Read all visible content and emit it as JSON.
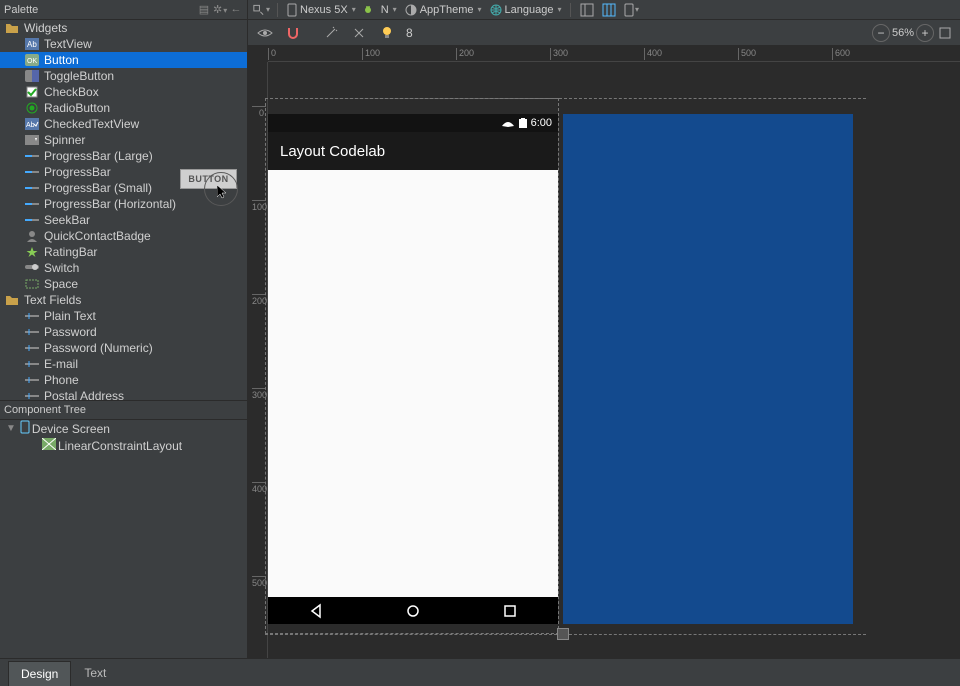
{
  "palette": {
    "title": "Palette",
    "groups": {
      "widgets_label": "Widgets",
      "text_fields_label": "Text Fields"
    },
    "widgets": [
      "TextView",
      "Button",
      "ToggleButton",
      "CheckBox",
      "RadioButton",
      "CheckedTextView",
      "Spinner",
      "ProgressBar (Large)",
      "ProgressBar",
      "ProgressBar (Small)",
      "ProgressBar (Horizontal)",
      "SeekBar",
      "QuickContactBadge",
      "RatingBar",
      "Switch",
      "Space"
    ],
    "text_fields": [
      "Plain Text",
      "Password",
      "Password (Numeric)",
      "E-mail",
      "Phone",
      "Postal Address"
    ],
    "selected_index": 1
  },
  "component_tree": {
    "title": "Component Tree",
    "root": "Device Screen",
    "child": "LinearConstraintLayout"
  },
  "toolbar": {
    "device": "Nexus 5X",
    "api": "N",
    "theme": "AppTheme",
    "lang": "Language"
  },
  "design_toolbar": {
    "value": "8",
    "zoom": "56%"
  },
  "device": {
    "time": "6:00",
    "title": "Layout Codelab"
  },
  "ruler_h": [
    "0",
    "100",
    "200",
    "300",
    "400",
    "500",
    "600"
  ],
  "ruler_v": [
    "0",
    "100",
    "200",
    "300",
    "400",
    "500"
  ],
  "drag_ghost": "BUTTON",
  "tabs": {
    "design": "Design",
    "text": "Text"
  }
}
